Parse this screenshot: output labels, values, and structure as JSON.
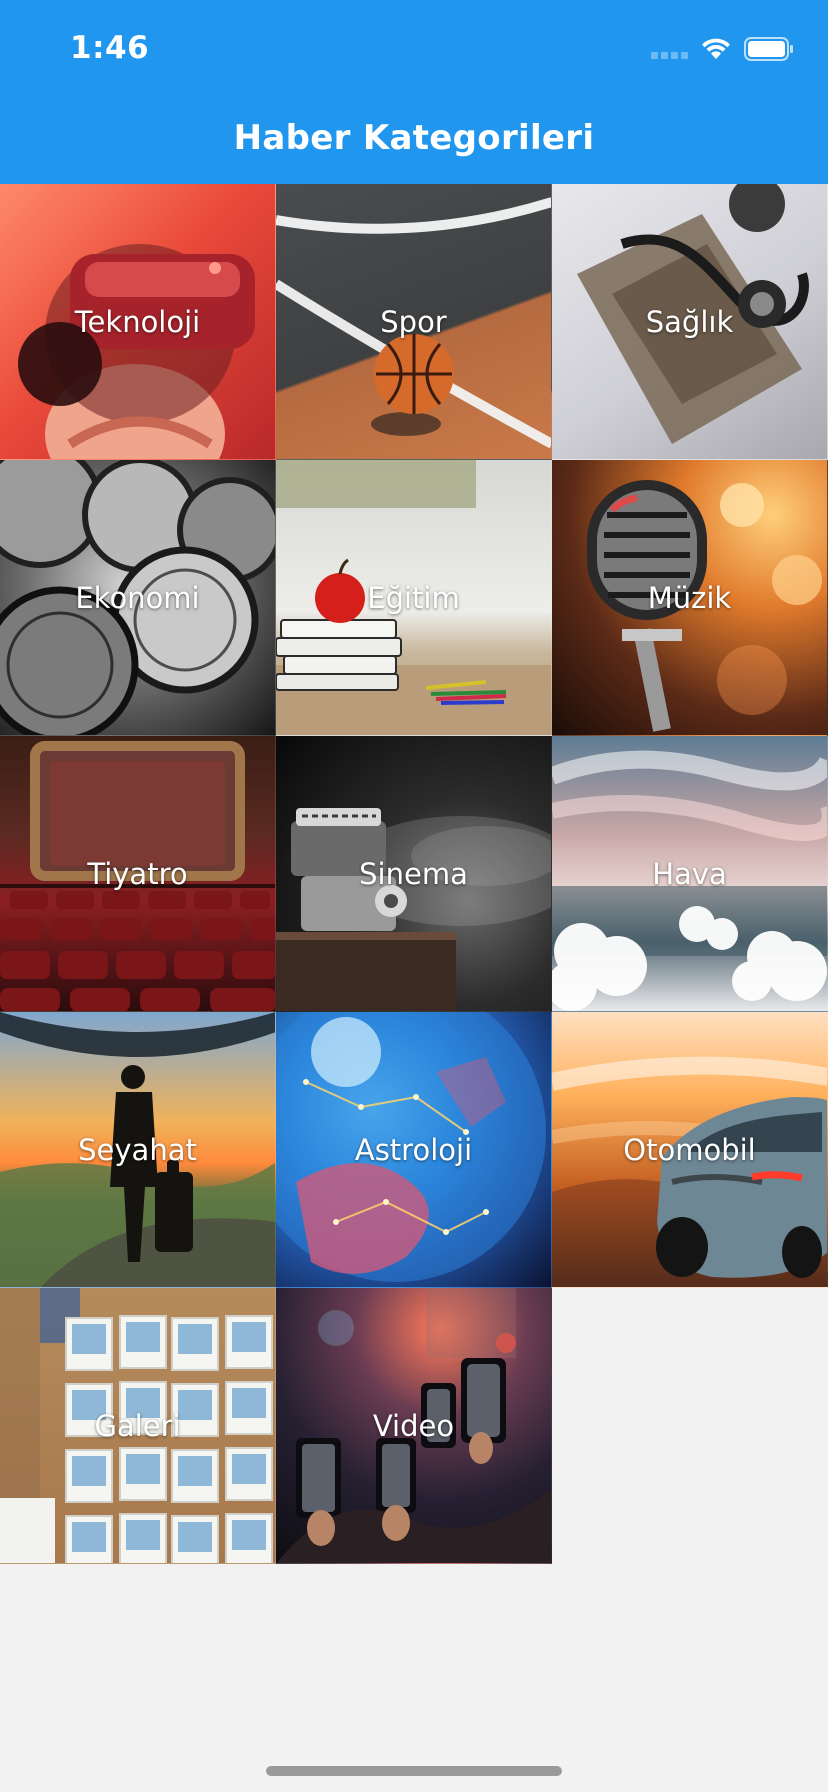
{
  "status_bar": {
    "time": "1:46"
  },
  "header": {
    "title": "Haber Kategorileri",
    "background": "#2196ee"
  },
  "categories": [
    {
      "label": "Teknoloji"
    },
    {
      "label": "Spor"
    },
    {
      "label": "Sağlık"
    },
    {
      "label": "Ekonomi"
    },
    {
      "label": "Eğitim"
    },
    {
      "label": "Müzik"
    },
    {
      "label": "Tiyatro"
    },
    {
      "label": "Sinema"
    },
    {
      "label": "Hava"
    },
    {
      "label": "Seyahat"
    },
    {
      "label": "Astroloji"
    },
    {
      "label": "Otomobil"
    },
    {
      "label": "Galeri"
    },
    {
      "label": "Video"
    }
  ]
}
